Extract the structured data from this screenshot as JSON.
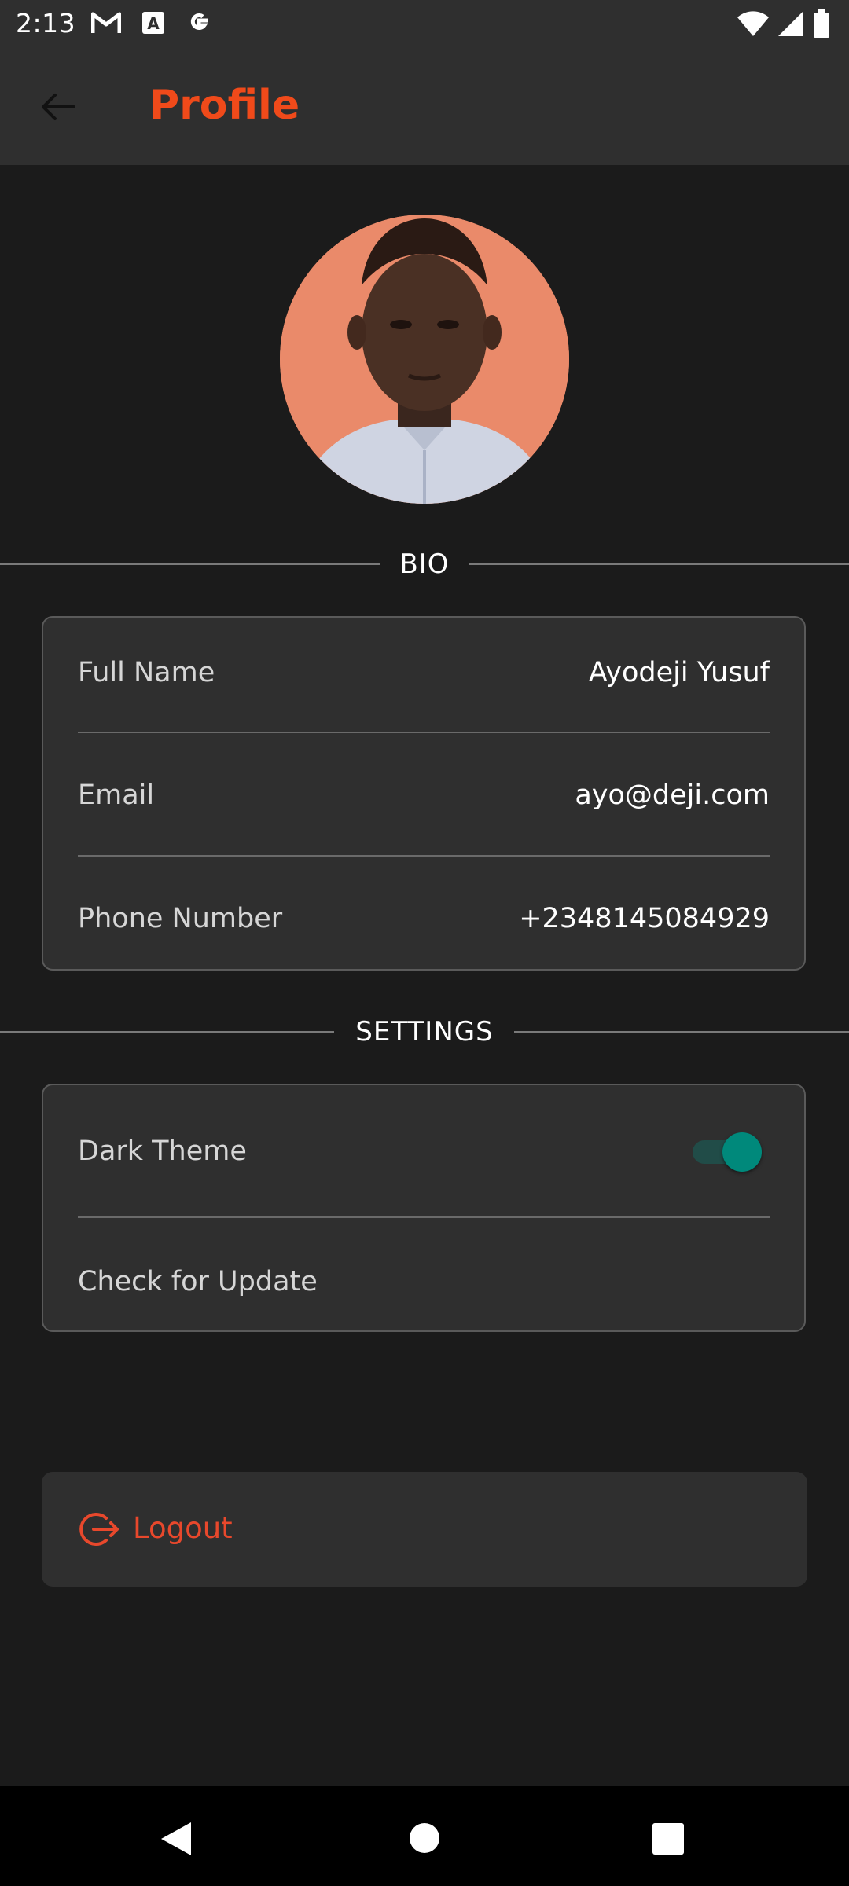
{
  "status_bar": {
    "time": "2:13",
    "left_icons": [
      "gmail-icon",
      "keyboard-a-icon",
      "google-icon"
    ],
    "right_icons": [
      "wifi-icon",
      "signal-icon",
      "battery-icon"
    ]
  },
  "app_bar": {
    "title": "Profile",
    "back_icon": "arrow-left-icon",
    "title_color": "#f04a1a"
  },
  "sections": {
    "bio_label": "BIO",
    "settings_label": "SETTINGS"
  },
  "bio": {
    "full_name_label": "Full Name",
    "full_name_value": "Ayodeji Yusuf",
    "email_label": "Email",
    "email_value": "ayo@deji.com",
    "phone_label": "Phone Number",
    "phone_value": "+2348145084929"
  },
  "settings": {
    "dark_theme_label": "Dark Theme",
    "dark_theme_on": true,
    "check_update_label": "Check for Update"
  },
  "logout": {
    "label": "Logout",
    "icon": "logout-icon",
    "color": "#e8482c"
  },
  "nav_bar": {
    "icons": [
      "back-triangle-icon",
      "home-circle-icon",
      "recents-square-icon"
    ]
  },
  "colors": {
    "background": "#1b1b1b",
    "surface": "#2f2f2f",
    "accent": "#f04a1a",
    "toggle": "#00897b"
  }
}
